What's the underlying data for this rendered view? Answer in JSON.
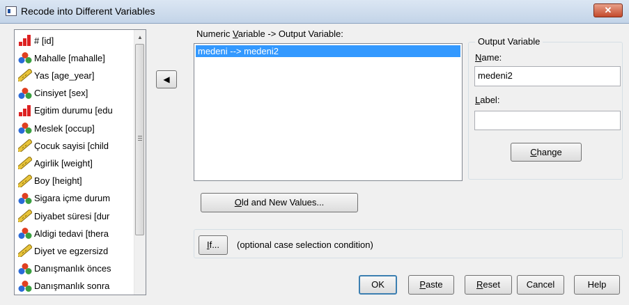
{
  "window": {
    "title": "Recode into Different Variables"
  },
  "variables": [
    {
      "label": "# [id]",
      "type": "ordinal"
    },
    {
      "label": "Mahalle [mahalle]",
      "type": "nominal"
    },
    {
      "label": "Yas [age_year]",
      "type": "scale"
    },
    {
      "label": "Cinsiyet [sex]",
      "type": "nominal"
    },
    {
      "label": "Egitim durumu [edu",
      "type": "ordinal"
    },
    {
      "label": "Meslek [occup]",
      "type": "nominal"
    },
    {
      "label": "Çocuk sayisi [child",
      "type": "scale"
    },
    {
      "label": "Agirlik [weight]",
      "type": "scale"
    },
    {
      "label": "Boy [height]",
      "type": "scale"
    },
    {
      "label": "Sigara içme durum",
      "type": "nominal"
    },
    {
      "label": "Diyabet süresi [dur",
      "type": "scale"
    },
    {
      "label": "Aldigi tedavi [thera",
      "type": "nominal"
    },
    {
      "label": "Diyet ve egzersizd",
      "type": "scale"
    },
    {
      "label": "Danışmanlık önces",
      "type": "nominal"
    },
    {
      "label": "Danışmanlık sonra",
      "type": "nominal"
    }
  ],
  "move_button": {
    "symbol": "◀"
  },
  "numeric_variable": {
    "label_pre": "Numeric ",
    "label_accel": "V",
    "label_post": "ariable -> Output Variable:",
    "items": [
      "medeni --> medeni2"
    ]
  },
  "output_variable": {
    "legend": "Output Variable",
    "name_label_accel": "N",
    "name_label_rest": "ame:",
    "name_value": "medeni2",
    "label_label_accel": "L",
    "label_label_rest": "abel:",
    "label_value": "",
    "change_accel": "C",
    "change_rest": "hange"
  },
  "old_new": {
    "accel": "O",
    "rest": "ld and New Values..."
  },
  "if_section": {
    "accel": "I",
    "rest": "f...",
    "text": "(optional case selection condition)"
  },
  "buttons": {
    "ok": "OK",
    "paste_accel": "P",
    "paste_rest": "aste",
    "reset_accel": "R",
    "reset_rest": "eset",
    "cancel": "Cancel",
    "help": "Help"
  },
  "colors": {
    "selection": "#3399ff",
    "close_button": "#c44a2c"
  }
}
